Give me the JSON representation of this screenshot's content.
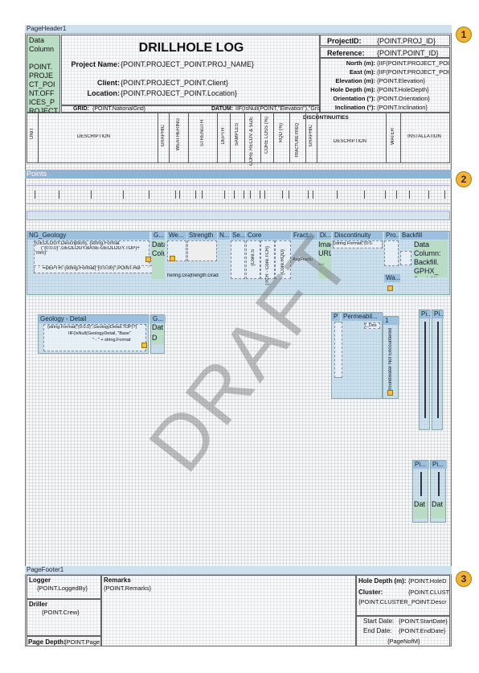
{
  "bands": {
    "page_header": "PageHeader1",
    "points": "Points",
    "page_footer": "PageFooter1"
  },
  "header": {
    "data_column": [
      "Data",
      "Column",
      "",
      "POINT.",
      "PROJE",
      "CT_POI",
      "NT.OFF",
      "ICES_P",
      "ROJECT"
    ],
    "title": "DRILLHOLE LOG",
    "project_name_label": "Project Name:",
    "project_name_value": "{POINT.PROJECT_POINT.PROJ_NAME}",
    "client_label": "Client:",
    "client_value": "{POINT.PROJECT_POINT.Client}",
    "location_label": "Location:",
    "location_value": "{POINT.PROJECT_POINT.Location}",
    "grid_label": "GRID:",
    "grid_value": "{POINT.NationalGrid}",
    "datum_label": "DATUM:",
    "datum_value": "IIF(IsNull(POINT,\"Elevation\"),\"Ground\",P",
    "projectid_label": "ProjectID:",
    "projectid_value": "{POINT.PROJ_ID}",
    "reference_label": "Reference:",
    "reference_value": "{POINT.POINT_ID}",
    "right_rows": [
      {
        "label": "North (m):",
        "value": "{IIF(POINT.PROJECT_POI"
      },
      {
        "label": "East (m):",
        "value": "{IIF(POINT.PROJECT_POI"
      },
      {
        "label": "Elevation (m):",
        "value": "{POINT.Elevation}"
      },
      {
        "label": "Hole Depth (m):",
        "value": "{POINT.HoleDepth}"
      },
      {
        "label": "Orientation (°):",
        "value": "{POINT.Orientation}"
      },
      {
        "label": "Inclination (°):",
        "value": "{POINT.Inclination}"
      }
    ]
  },
  "columns": {
    "discontinuities": "DISCONTINUITIES",
    "unit": "UNIT",
    "description": "DESCRIPTION",
    "graphic": "GRAPHIC",
    "weathering": "WEATHERING",
    "strength": "STRENGTH",
    "depth": "DEPTH",
    "samples": "SAMPLES",
    "core_recov": "CORE RECOV & SIZE",
    "core_loss": "CORE LOSS (%)",
    "rqd": "RQD (%)",
    "fracture_freq": "FRACTURE FREQ",
    "disc_graphic": "GRAPHIC",
    "disc_description": "DESCRIPTION",
    "water": "WATER",
    "installation": "INSTALLATION"
  },
  "panels": {
    "geology": "NG_Geology",
    "geology_g": "G...",
    "weathering": "We...",
    "strength": "Strength",
    "n": "N...",
    "se": "Se...",
    "core": "Core",
    "fract": "Fract...",
    "di": "Di...",
    "discontinuity": "Discontinuity",
    "pro": "Pro...",
    "backfill": "Backfill",
    "wa": "Wa...",
    "geology_detail": "Geology - Detail",
    "g2": "G...",
    "permeability": "Permeabil...",
    "p": "P",
    "one": "1",
    "pi": "Pi...",
    "pi2": "Pi..."
  },
  "panel_text": {
    "geol_desc": "{GEOLOGY.Description}, {string.Format",
    "geol_line2": "(\"{0:0.0}\",GEOLOGY.BASE-GEOLOGY.TOP)+",
    "geol_line3": "\"mm)\"",
    "geol_depth": "=DEPTH: {string.Format(\"{0:0.00}\",POINT.Hol",
    "data_column": "Data Column",
    "backfill_col": "Data Column: Backfill. GPHX_ Backfill",
    "image_url": "Image URL ...",
    "weathering_strength": "hering.Gra|trength.Grade,st",
    "detail_line1": "{string.Format(\"{0:0.0}\",GeologyDetail.TOP)?}",
    "detail_line2": "IIF(IsNull(GeologyDetail, \"Base\"",
    "detail_line3": "\" - \" + string.Format",
    "disc_format": "{string.Format(\"{0:0.",
    "dat": "Dat",
    "d": "D",
    "groundwater": "Groundwater Not Encountered",
    "permeab_val": "{_Des",
    "avg_frac": "AvgFractu",
    "core_rqd": "{Core.RQD}",
    "tcr": "{TCR - Core.TCR}",
    "core_s": "{Core.S"
  },
  "watermark": "DRAFT",
  "footer": {
    "logger_label": "Logger",
    "logger_value": "{POINT.LoggedBy}",
    "remarks_label": "Remarks",
    "remarks_value": "{POINT.Remarks}",
    "driller_label": "Driller",
    "driller_value": "{POINT.Crew}",
    "page_depth_label": "Page Depth:",
    "page_depth_value": "{POINT.Page",
    "hole_depth_label": "Hole Depth (m):",
    "hole_depth_value": "{POINT.HoleD",
    "cluster_label": "Cluster:",
    "cluster_value": "{POINT.CLUST",
    "cluster_desc": "{POINT.CLUSTER_POINT.Descr",
    "start_date_label": "Start Date:",
    "start_date_value": "{POINT.StartDate}",
    "end_date_label": "End Date:",
    "end_date_value": "{POINT.EndDate}",
    "page_of": "{PageNofM}"
  },
  "callouts": [
    "1",
    "2",
    "3"
  ]
}
